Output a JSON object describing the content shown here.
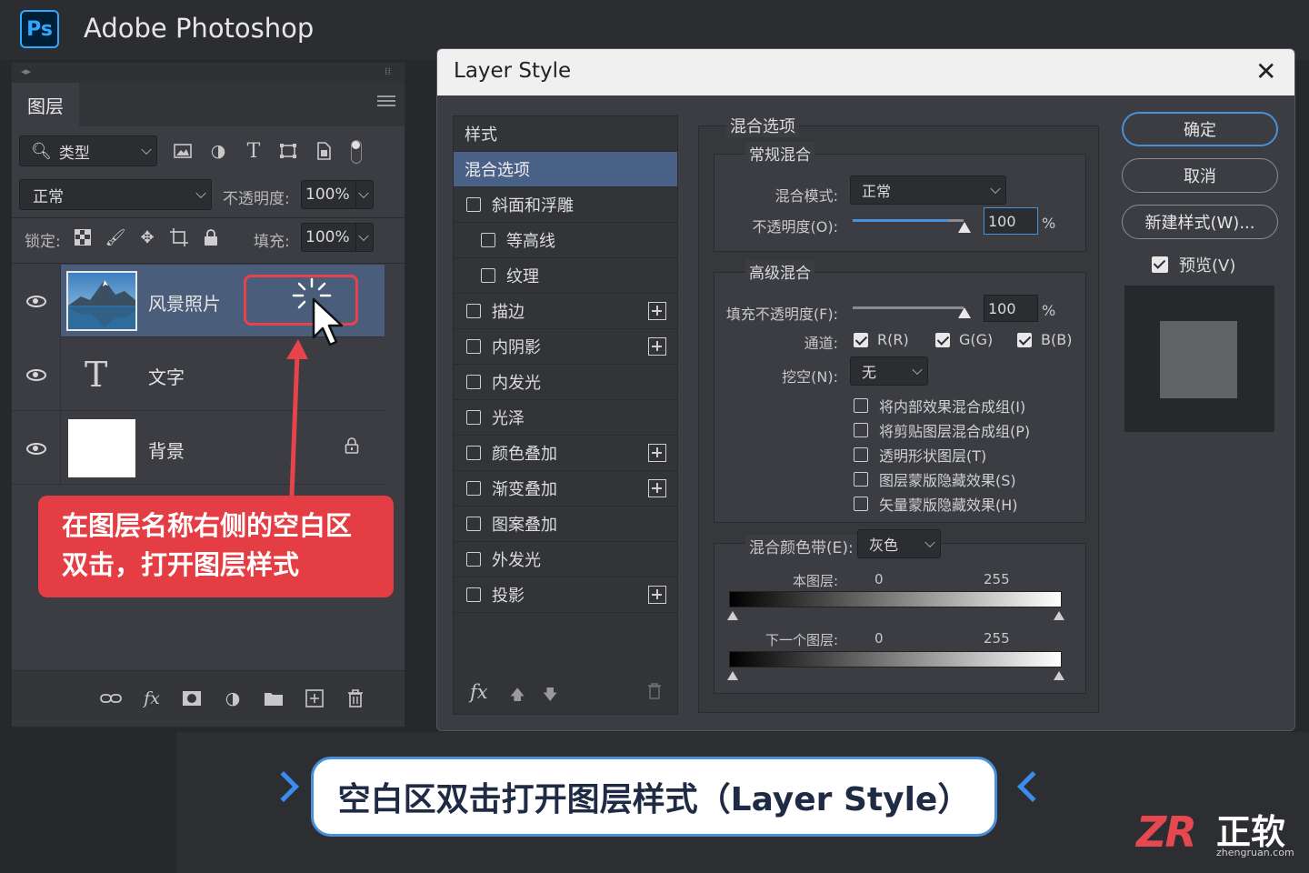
{
  "app": {
    "title": "Adobe Photoshop",
    "logo": "Ps"
  },
  "layers_panel": {
    "tab": "图层",
    "filter": {
      "label": "类型"
    },
    "blend_mode": "正常",
    "opacity_label": "不透明度:",
    "opacity_value": "100%",
    "lock_label": "锁定:",
    "fill_label": "填充:",
    "fill_value": "100%",
    "layers": [
      {
        "name": "风景照片"
      },
      {
        "name": "文字",
        "thumb": "T"
      },
      {
        "name": "背景"
      }
    ],
    "callout_lines": [
      "在图层名称右侧的空白区",
      "双击，打开图层样式"
    ],
    "footer_fx": "fx"
  },
  "dialog": {
    "title": "Layer Style",
    "style_list": {
      "header": "样式",
      "items": [
        {
          "label": "混合选项",
          "active": true
        },
        {
          "label": "斜面和浮雕"
        },
        {
          "label": "等高线"
        },
        {
          "label": "纹理"
        },
        {
          "label": "描边"
        },
        {
          "label": "内阴影"
        },
        {
          "label": "内发光"
        },
        {
          "label": "光泽"
        },
        {
          "label": "颜色叠加"
        },
        {
          "label": "渐变叠加"
        },
        {
          "label": "图案叠加"
        },
        {
          "label": "外发光"
        },
        {
          "label": "投影"
        }
      ],
      "footer_fx": "fx"
    },
    "blending": {
      "title": "混合选项",
      "general_title": "常规混合",
      "blend_mode_label": "混合模式:",
      "blend_mode_value": "正常",
      "opacity_label": "不透明度(O):",
      "opacity_value": "100",
      "percent": "%",
      "advanced_title": "高级混合",
      "fill_opacity_label": "填充不透明度(F):",
      "fill_opacity_value": "100",
      "channels_label": "通道:",
      "channels": [
        "R(R)",
        "G(G)",
        "B(B)"
      ],
      "knockout_label": "挖空(N):",
      "knockout_value": "无",
      "options": [
        "将内部效果混合成组(I)",
        "将剪贴图层混合成组(P)",
        "透明形状图层(T)",
        "图层蒙版隐藏效果(S)",
        "矢量蒙版隐藏效果(H)"
      ],
      "blend_if_label": "混合颜色带(E):",
      "blend_if_value": "灰色",
      "this_layer_label": "本图层:",
      "underlying_label": "下一个图层:",
      "range_min": "0",
      "range_max": "255"
    },
    "buttons": {
      "ok": "确定",
      "cancel": "取消",
      "new_style": "新建样式(W)..."
    },
    "preview_label": "预览(V)"
  },
  "caption": "空白区双击打开图层样式（Layer Style）",
  "watermark": {
    "logo": "ZR",
    "name": "正软",
    "url": "zhengruan.com"
  },
  "colors": {
    "accent_blue": "#4a90d9",
    "callout_red": "#e43d43",
    "selected_layer": "#4a5d7b"
  }
}
